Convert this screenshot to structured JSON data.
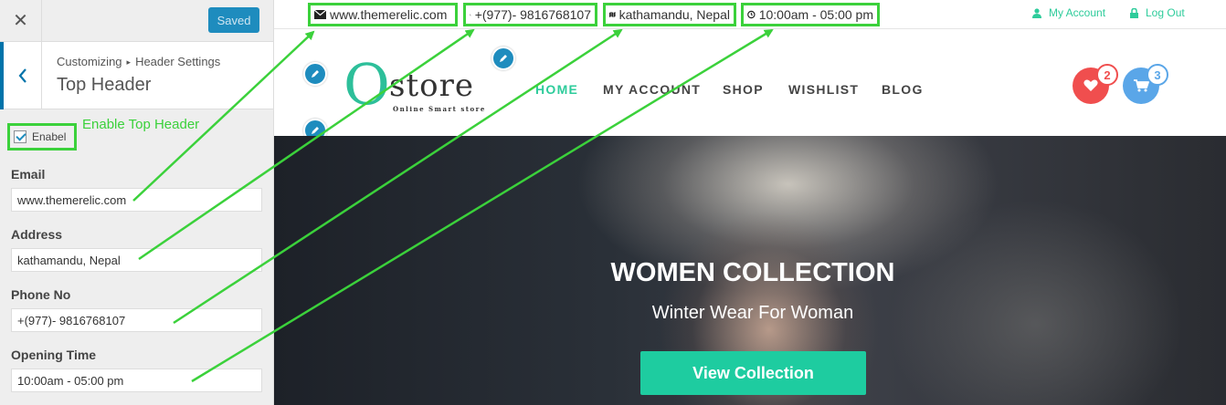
{
  "customizer": {
    "saved_label": "Saved",
    "breadcrumb_root": "Customizing",
    "breadcrumb_current": "Header Settings",
    "section_title": "Top Header",
    "enable_label": "Enabel",
    "annotation": "Enable Top Header",
    "fields": {
      "email_label": "Email",
      "email_value": "www.themerelic.com",
      "address_label": "Address",
      "address_value": "kathamandu, Nepal",
      "phone_label": "Phone No",
      "phone_value": "+(977)- 9816768107",
      "time_label": "Opening Time",
      "time_value": "10:00am - 05:00 pm"
    }
  },
  "topbar": {
    "email": "www.themerelic.com",
    "phone": "+(977)- 9816768107",
    "address": "kathamandu, Nepal",
    "hours": "10:00am - 05:00 pm",
    "my_account": "My Account",
    "logout": "Log Out"
  },
  "header": {
    "logo_letter": "O",
    "logo_text": "store",
    "logo_tagline": "Online Smart store",
    "nav": [
      "HOME",
      "MY ACCOUNT",
      "SHOP",
      "WISHLIST",
      "BLOG"
    ],
    "wishlist_count": "2",
    "cart_count": "3"
  },
  "hero": {
    "title": "WOMEN COLLECTION",
    "subtitle": "Winter Wear For Woman",
    "button": "View Collection"
  },
  "colors": {
    "accent": "#2ecc9b",
    "annotation": "#3bd13b",
    "wp_blue": "#1e8cbe",
    "wishlist": "#f04e4e",
    "cart": "#5aa6e8"
  }
}
